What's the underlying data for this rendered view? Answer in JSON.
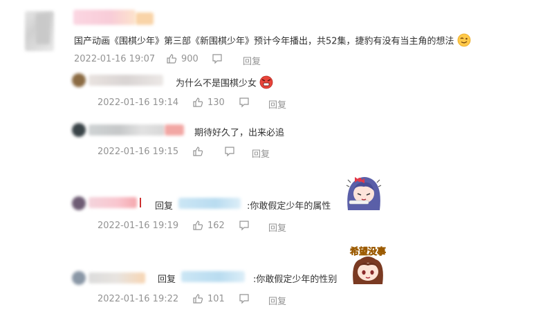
{
  "main_comment": {
    "text": "国产动画《围棋少年》第三部《新围棋少年》预计今年播出，共52集，捷豹有没有当主角的想法",
    "time": "2022-01-16 19:07",
    "likes": "900",
    "reply_label": "回复"
  },
  "replies": [
    {
      "text": "为什么不是围棋少女",
      "time": "2022-01-16 19:14",
      "likes": "130",
      "reply_label": "回复"
    },
    {
      "text": "期待好久了，出来必追",
      "time": "2022-01-16 19:15",
      "likes": "",
      "reply_label": "回复"
    },
    {
      "prefix": "回复",
      "text": ":你敢假定少年的属性",
      "time": "2022-01-16 19:19",
      "likes": "162",
      "reply_label": "回复"
    },
    {
      "prefix": "回复",
      "text": ":你敢假定少年的性别",
      "time": "2022-01-16 19:22",
      "likes": "101",
      "reply_label": "回复"
    }
  ],
  "sticker_caption": "希望没事",
  "colors": {
    "meta": "#939393",
    "text": "#333333"
  }
}
